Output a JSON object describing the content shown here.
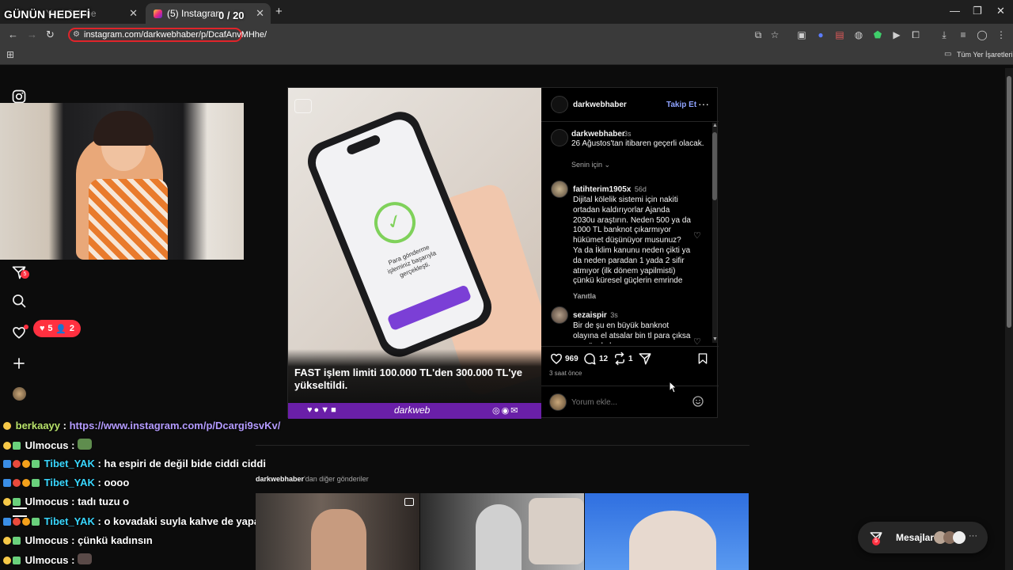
{
  "overlay": {
    "title": "GÜNÜN HEDEFİ",
    "counter": "0 / 20"
  },
  "browser": {
    "tabs": [
      {
        "label": "Yeni Sekme"
      },
      {
        "label": "(5) Instagram"
      }
    ],
    "new_tab": "+",
    "url": "instagram.com/darkwebhaber/p/DcafAnvMHhe/",
    "bookmarks_label": "Tüm Yer İşaretleri"
  },
  "sidebar": {
    "activity_badge": "5",
    "notif_likes": "5",
    "notif_follows": "2"
  },
  "chat": [
    {
      "nick": "berkaayy",
      "nick_color": "#b9e36b",
      "text": "https://www.instagram.com/p/Dcargi9svKv/",
      "text_color": "#b49bff"
    },
    {
      "nick": "Ulmocus",
      "nick_color": "#ffffff",
      "text": "",
      "text_color": "#ffffff"
    },
    {
      "nick": "Tibet_YAK",
      "nick_color": "#39d7ff",
      "text": "ha espiri de değil bide ciddi ciddi",
      "text_color": "#ffffff"
    },
    {
      "nick": "Tibet_YAK",
      "nick_color": "#39d7ff",
      "text": "oooo",
      "text_color": "#ffffff"
    },
    {
      "nick": "Ulmocus",
      "nick_color": "#ffffff",
      "text": "tadı tuzu o",
      "text_color": "#ffffff"
    },
    {
      "nick": "Tibet_YAK",
      "nick_color": "#39d7ff",
      "text": "o kovadaki suyla kahve de yaparlar",
      "text_color": "#ffffff"
    },
    {
      "nick": "Ulmocus",
      "nick_color": "#ffffff",
      "text": "çünkü kadınsın",
      "text_color": "#ffffff"
    },
    {
      "nick": "Ulmocus",
      "nick_color": "#ffffff",
      "text": "",
      "text_color": "#ffffff"
    }
  ],
  "post": {
    "headline": "FAST işlem limiti 100.000 TL'den 300.000 TL'ye yükseltildi.",
    "phone_text": "Para gönderme işleminiz başarıyla gerçekleşti.",
    "brand": "darkweb",
    "author": "darkwebhaber",
    "follow_label": "Takip Et",
    "caption_user": "darkwebhaber",
    "caption_time": "3s",
    "caption_text": "26 Ağustos'tan itibaren geçerli olacak.",
    "sort_label": "Senin için",
    "comments": [
      {
        "user": "fatihterim1905x",
        "time": "56d",
        "text": "Dijital kölelik sistemi için nakiti ortadan kaldırıyorlar Ajanda 2030u araştırın. Neden 500 ya da 1000 TL banknot çıkarmıyor hükümet düşünüyor musunuz? Ya da İklim kanunu neden çikti ya da neden paradan 1 yada 2 sifir atmıyor (ilk dönem yapilmisti) çünkü küresel güçlerin emrinde",
        "reply_label": "Yanıtla"
      },
      {
        "user": "sezaispir",
        "time": "3s",
        "text": "Bir de şu en büyük banknot olayına el atsalar bin tl para çıksa ne güzel olur.",
        "reply_label": ""
      }
    ],
    "likes": "969",
    "comment_count": "12",
    "repost_count": "1",
    "posted_ago": "3 saat önce",
    "comment_placeholder": "Yorum ekle..."
  },
  "more": {
    "user": "darkwebhaber",
    "suffix": "'dan diğer gönderiler"
  },
  "messages": {
    "label": "Mesajlar",
    "badge": "5"
  },
  "colors": {
    "accent_purple": "#6a1fa8",
    "follow_blue": "#8fa3ff",
    "notif_red": "#ff3040",
    "url_highlight": "#e0242a"
  }
}
